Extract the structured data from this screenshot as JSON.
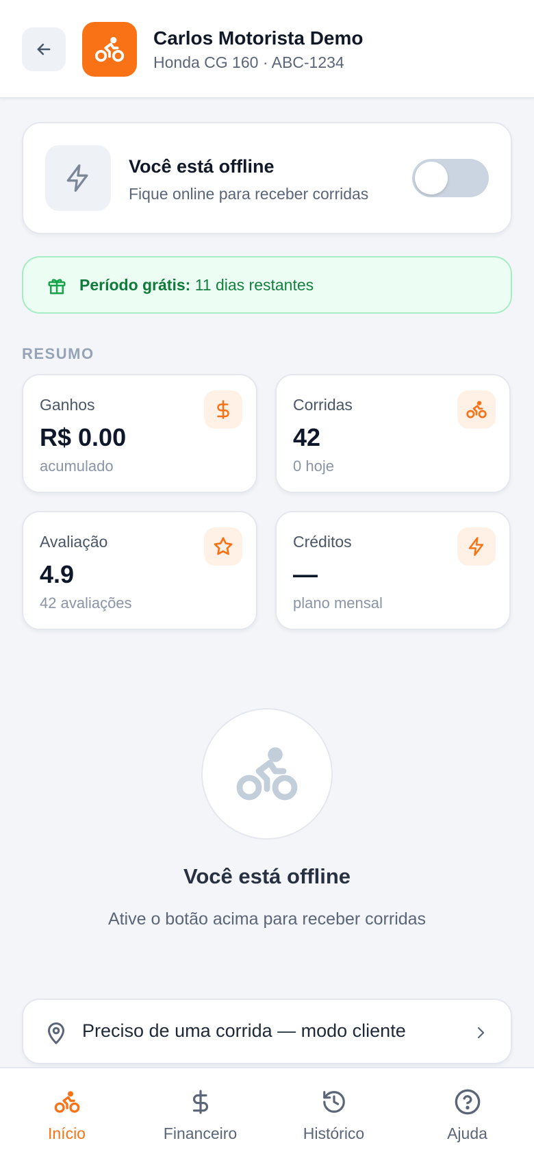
{
  "colors": {
    "accent": "#f97316",
    "accent_soft": "#fff1e6",
    "success_bg": "#ecfdf3",
    "success_text": "#15803d",
    "muted": "#94a3b8",
    "toggle_off": "#cbd5e1"
  },
  "header": {
    "back_icon": "arrow-left-icon",
    "logo_icon": "bike-icon",
    "driver_name": "Carlos Motorista Demo",
    "vehicle": "Honda CG 160 · ABC-1234"
  },
  "status": {
    "icon": "lightning-icon",
    "title": "Você está offline",
    "subtitle": "Fique online para receber corridas",
    "online": false
  },
  "trial": {
    "icon": "gift-icon",
    "label": "Período grátis:",
    "text": "11 dias restantes"
  },
  "summary": {
    "section_label": "RESUMO",
    "cards": [
      {
        "label": "Ganhos",
        "value": "R$ 0.00",
        "sub": "acumulado",
        "icon": "dollar-icon"
      },
      {
        "label": "Corridas",
        "value": "42",
        "sub": "0 hoje",
        "icon": "bike-icon"
      },
      {
        "label": "Avaliação",
        "value": "4.9",
        "sub": "42 avaliações",
        "icon": "star-icon"
      },
      {
        "label": "Créditos",
        "value": "—",
        "sub": "plano mensal",
        "icon": "lightning-icon"
      }
    ]
  },
  "empty_state": {
    "icon": "bike-icon",
    "title": "Você está offline",
    "subtitle": "Ative o botão acima para receber corridas"
  },
  "client_mode": {
    "icon": "location-pin-icon",
    "label": "Preciso de uma corrida — modo cliente",
    "chevron": "chevron-right-icon"
  },
  "nav": {
    "items": [
      {
        "label": "Início",
        "icon": "bike-icon",
        "active": true
      },
      {
        "label": "Financeiro",
        "icon": "dollar-icon",
        "active": false
      },
      {
        "label": "Histórico",
        "icon": "history-icon",
        "active": false
      },
      {
        "label": "Ajuda",
        "icon": "help-circle-icon",
        "active": false
      }
    ]
  }
}
